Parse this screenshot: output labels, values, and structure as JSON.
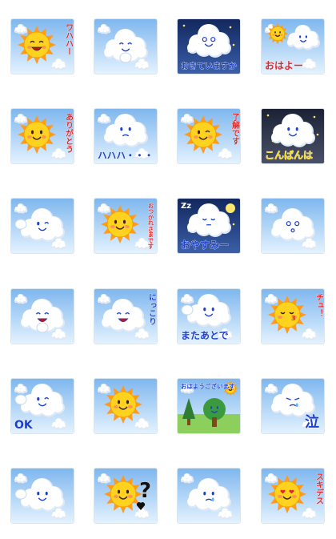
{
  "palette": {
    "sky_top": "#7fb7ee",
    "sky_bottom": "#e3f2ff",
    "night_top": "#12285e",
    "night_bottom": "#3b5fa8",
    "sun": "#ffd21f",
    "sun_ray": "#ff9a1e",
    "cloud": "#ffffff",
    "text_blue": "#1a3fd1",
    "text_red": "#e0262a",
    "text_yellow": "#ffd800"
  },
  "stickers": [
    {
      "id": "s01",
      "character": "sun",
      "sky": "day",
      "caption": "ワハハー",
      "caption_color": "#e0262a",
      "vertical": true,
      "expression": "laugh"
    },
    {
      "id": "s02",
      "character": "cloud",
      "sky": "day",
      "caption": "",
      "expression": "giggle-hand"
    },
    {
      "id": "s03",
      "character": "cloud",
      "sky": "night",
      "caption": "おきていますか",
      "caption_color": "#1a3fd1",
      "vertical": false,
      "expression": "sparkle-eyes"
    },
    {
      "id": "s04",
      "character": "sun+cloud",
      "sky": "day",
      "caption": "おはよー",
      "caption_color": "#e0262a",
      "vertical": false,
      "expression": "smile"
    },
    {
      "id": "s05",
      "character": "sun",
      "sky": "day",
      "caption": "ありがとう",
      "caption_color": "#e0262a",
      "vertical": true,
      "expression": "smile"
    },
    {
      "id": "s06",
      "character": "cloud",
      "sky": "day",
      "caption": "ハハハ・・・",
      "caption_color": "#1a3fd1",
      "vertical": false,
      "expression": "awkward"
    },
    {
      "id": "s07",
      "character": "sun",
      "sky": "day",
      "caption": "了解です",
      "caption_color": "#e0262a",
      "vertical": true,
      "expression": "wink"
    },
    {
      "id": "s08",
      "character": "cloud",
      "sky": "dark",
      "caption": "こんばんは",
      "caption_color": "#ffd800",
      "vertical": false,
      "expression": "smile"
    },
    {
      "id": "s09",
      "character": "cloud",
      "sky": "day",
      "caption": "",
      "expression": "peace-sign"
    },
    {
      "id": "s10",
      "character": "sun",
      "sky": "day",
      "caption": "おつかれさまです",
      "caption_color": "#e0262a",
      "vertical": true,
      "expression": "blush"
    },
    {
      "id": "s11",
      "character": "cloud",
      "sky": "night",
      "caption": "おやすみー",
      "caption_color": "#1a3fd1",
      "vertical": false,
      "expression": "sleep"
    },
    {
      "id": "s12",
      "character": "cloud",
      "sky": "day",
      "caption": "",
      "expression": "dizzy"
    },
    {
      "id": "s13",
      "character": "cloud",
      "sky": "day",
      "caption": "",
      "expression": "excited"
    },
    {
      "id": "s14",
      "character": "cloud",
      "sky": "day",
      "caption": "にっこり",
      "caption_color": "#1a3fd1",
      "vertical": true,
      "expression": "grin"
    },
    {
      "id": "s15",
      "character": "cloud",
      "sky": "day",
      "caption": "またあとで",
      "caption_color": "#1a3fd1",
      "vertical": false,
      "expression": "wave"
    },
    {
      "id": "s16",
      "character": "sun",
      "sky": "day",
      "caption": "チュ！",
      "caption_color": "#e0262a",
      "vertical": true,
      "expression": "kiss"
    },
    {
      "id": "s17",
      "character": "cloud",
      "sky": "day",
      "caption": "OK",
      "caption_color": "#1a3fd1",
      "vertical": false,
      "expression": "wink-ok"
    },
    {
      "id": "s18",
      "character": "sun",
      "sky": "day",
      "caption": "",
      "expression": "smile"
    },
    {
      "id": "s19",
      "character": "sun+trees",
      "sky": "day",
      "caption": "おはようございます",
      "caption_color": "#1a3fd1",
      "vertical": false,
      "expression": "smile"
    },
    {
      "id": "s20",
      "character": "cloud",
      "sky": "day",
      "caption": "泣",
      "caption_color": "#1a3fd1",
      "vertical": false,
      "expression": "cry"
    },
    {
      "id": "s21",
      "character": "cloud",
      "sky": "day",
      "caption": "",
      "expression": "thumbs-up"
    },
    {
      "id": "s22",
      "character": "sun",
      "sky": "day",
      "caption": "?",
      "caption_color": "#111111",
      "vertical": false,
      "expression": "wonder"
    },
    {
      "id": "s23",
      "character": "cloud",
      "sky": "day",
      "caption": "",
      "expression": "teary"
    },
    {
      "id": "s24",
      "character": "sun",
      "sky": "day",
      "caption": "スキデス",
      "caption_color": "#e0262a",
      "vertical": true,
      "expression": "heart-eyes"
    }
  ]
}
